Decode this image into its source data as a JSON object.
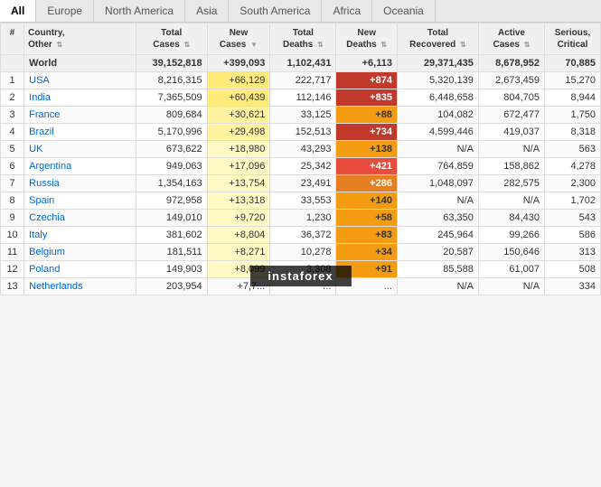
{
  "tabs": [
    "All",
    "Europe",
    "North America",
    "Asia",
    "South America",
    "Africa",
    "Oceania"
  ],
  "activeTab": "All",
  "columns": {
    "rank": "#",
    "country": "Country, Other",
    "totalCases": "Total Cases",
    "newCases": "New Cases",
    "totalDeaths": "Total Deaths",
    "newDeaths": "New Deaths",
    "totalRecovered": "Total Recovered",
    "activeCases": "Active Cases",
    "seriousCritical": "Serious, Critical"
  },
  "worldRow": {
    "country": "World",
    "totalCases": "39,152,818",
    "newCases": "+399,093",
    "totalDeaths": "1,102,431",
    "newDeaths": "+6,113",
    "totalRecovered": "29,371,435",
    "activeCases": "8,678,952",
    "seriousCritical": "70,885"
  },
  "rows": [
    {
      "rank": "1",
      "country": "USA",
      "totalCases": "8,216,315",
      "newCases": "+66,129",
      "totalDeaths": "222,717",
      "newDeaths": "+874",
      "totalRecovered": "5,320,139",
      "activeCases": "2,673,459",
      "seriousCritical": "15,270"
    },
    {
      "rank": "2",
      "country": "India",
      "totalCases": "7,365,509",
      "newCases": "+60,439",
      "totalDeaths": "112,146",
      "newDeaths": "+835",
      "totalRecovered": "6,448,658",
      "activeCases": "804,705",
      "seriousCritical": "8,944"
    },
    {
      "rank": "3",
      "country": "France",
      "totalCases": "809,684",
      "newCases": "+30,621",
      "totalDeaths": "33,125",
      "newDeaths": "+88",
      "totalRecovered": "104,082",
      "activeCases": "672,477",
      "seriousCritical": "1,750"
    },
    {
      "rank": "4",
      "country": "Brazil",
      "totalCases": "5,170,996",
      "newCases": "+29,498",
      "totalDeaths": "152,513",
      "newDeaths": "+734",
      "totalRecovered": "4,599,446",
      "activeCases": "419,037",
      "seriousCritical": "8,318"
    },
    {
      "rank": "5",
      "country": "UK",
      "totalCases": "673,622",
      "newCases": "+18,980",
      "totalDeaths": "43,293",
      "newDeaths": "+138",
      "totalRecovered": "N/A",
      "activeCases": "N/A",
      "seriousCritical": "563"
    },
    {
      "rank": "6",
      "country": "Argentina",
      "totalCases": "949,063",
      "newCases": "+17,096",
      "totalDeaths": "25,342",
      "newDeaths": "+421",
      "totalRecovered": "764,859",
      "activeCases": "158,862",
      "seriousCritical": "4,278"
    },
    {
      "rank": "7",
      "country": "Russia",
      "totalCases": "1,354,163",
      "newCases": "+13,754",
      "totalDeaths": "23,491",
      "newDeaths": "+286",
      "totalRecovered": "1,048,097",
      "activeCases": "282,575",
      "seriousCritical": "2,300"
    },
    {
      "rank": "8",
      "country": "Spain",
      "totalCases": "972,958",
      "newCases": "+13,318",
      "totalDeaths": "33,553",
      "newDeaths": "+140",
      "totalRecovered": "N/A",
      "activeCases": "N/A",
      "seriousCritical": "1,702"
    },
    {
      "rank": "9",
      "country": "Czechia",
      "totalCases": "149,010",
      "newCases": "+9,720",
      "totalDeaths": "1,230",
      "newDeaths": "+58",
      "totalRecovered": "63,350",
      "activeCases": "84,430",
      "seriousCritical": "543"
    },
    {
      "rank": "10",
      "country": "Italy",
      "totalCases": "381,602",
      "newCases": "+8,804",
      "totalDeaths": "36,372",
      "newDeaths": "+83",
      "totalRecovered": "245,964",
      "activeCases": "99,266",
      "seriousCritical": "586"
    },
    {
      "rank": "11",
      "country": "Belgium",
      "totalCases": "181,511",
      "newCases": "+8,271",
      "totalDeaths": "10,278",
      "newDeaths": "+34",
      "totalRecovered": "20,587",
      "activeCases": "150,646",
      "seriousCritical": "313"
    },
    {
      "rank": "12",
      "country": "Poland",
      "totalCases": "149,903",
      "newCases": "+8,099",
      "totalDeaths": "3,308",
      "newDeaths": "+91",
      "totalRecovered": "85,588",
      "activeCases": "61,007",
      "seriousCritical": "508"
    },
    {
      "rank": "13",
      "country": "Netherlands",
      "totalCases": "203,954",
      "newCases": "+7,7...",
      "totalDeaths": "...",
      "newDeaths": "...",
      "totalRecovered": "N/A",
      "activeCases": "N/A",
      "seriousCritical": "334"
    }
  ],
  "watermark": "instaforex"
}
